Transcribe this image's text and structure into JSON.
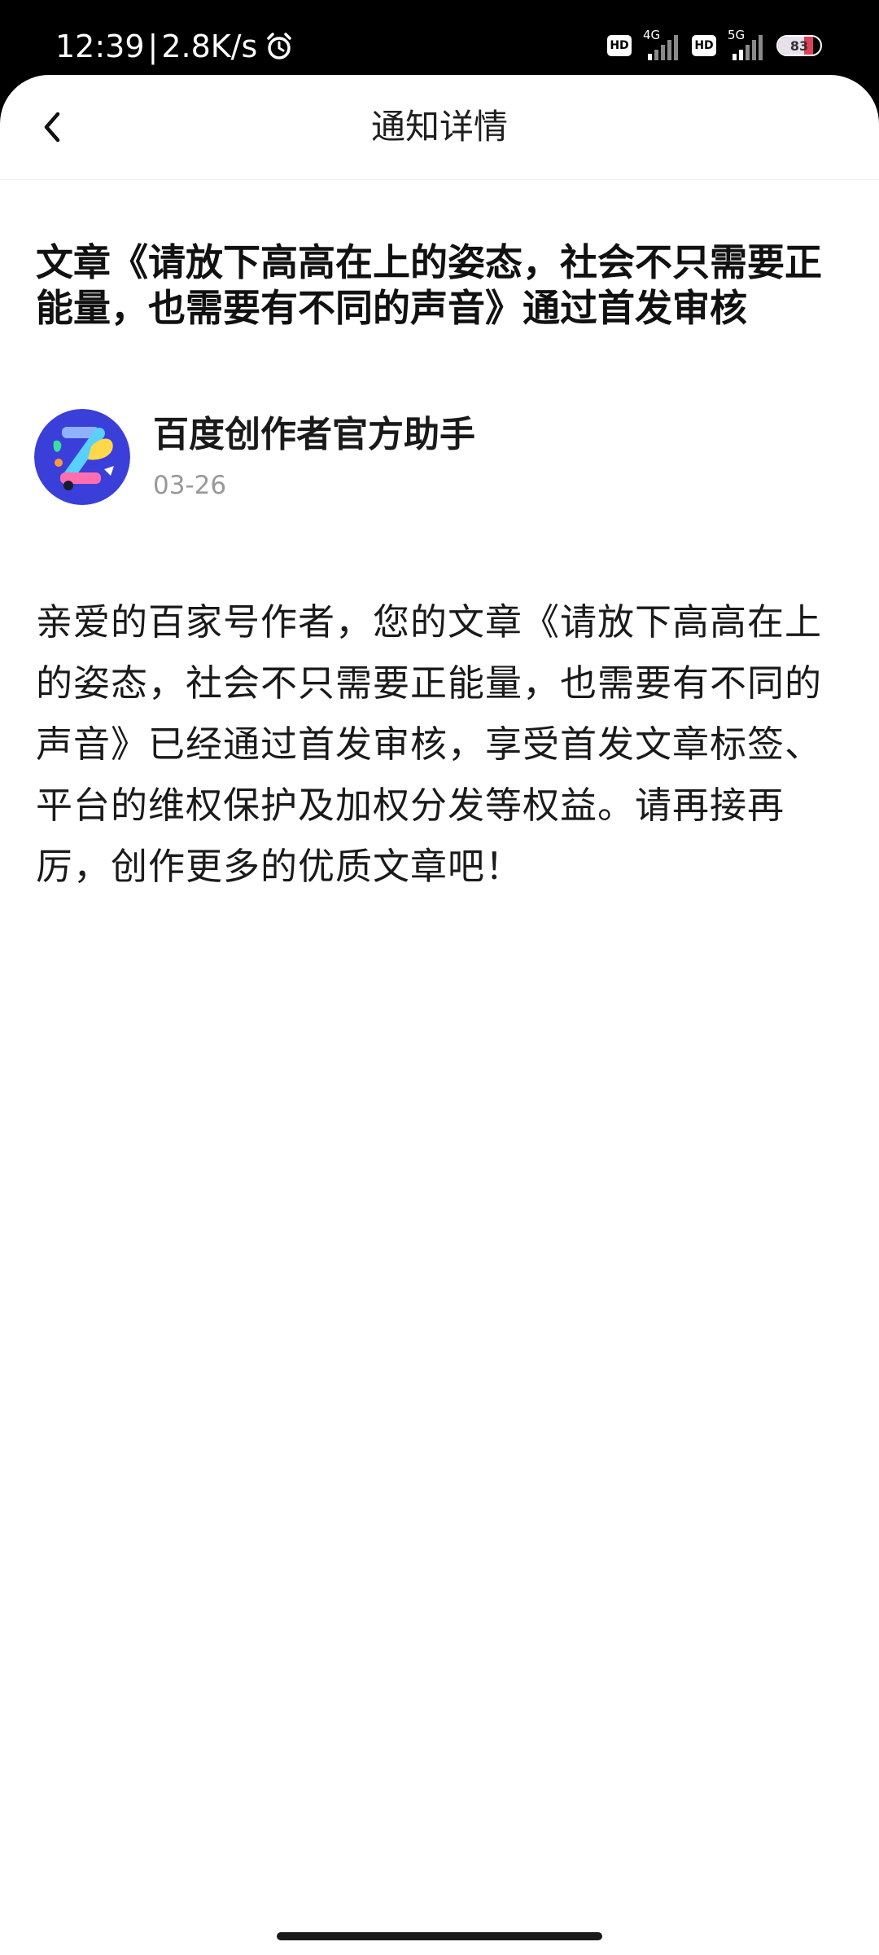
{
  "status_bar": {
    "time": "12:39",
    "separator": "|",
    "net_speed": "2.8K/s",
    "icons": [
      "alarm-icon"
    ],
    "sim1": {
      "badge": "HD",
      "network": "4G"
    },
    "sim2": {
      "badge": "HD",
      "network": "5G"
    },
    "battery": {
      "level": "83",
      "fraction": 0.83
    }
  },
  "nav": {
    "back_icon": "chevron-left-icon",
    "title": "通知详情"
  },
  "notification": {
    "title": "文章《请放下高高在上的姿态，社会不只需要正能量，也需要有不同的声音》通过首发审核",
    "author": {
      "name": "百度创作者官方助手",
      "date": "03-26"
    },
    "body": "亲爱的百家号作者，您的文章《请放下高高在上的姿态，社会不只需要正能量，也需要有不同的声音》已经通过首发审核，享受首发文章标签、平台的维权保护及加权分发等权益。请再接再厉，创作更多的优质文章吧！"
  },
  "colors": {
    "status_bar_bg": "#000000",
    "page_bg": "#ffffff",
    "text_primary": "#1a1a1a",
    "text_secondary": "#999999",
    "avatar_bg": "#3b3fd9",
    "battery_low_segment": "#e0405a"
  }
}
